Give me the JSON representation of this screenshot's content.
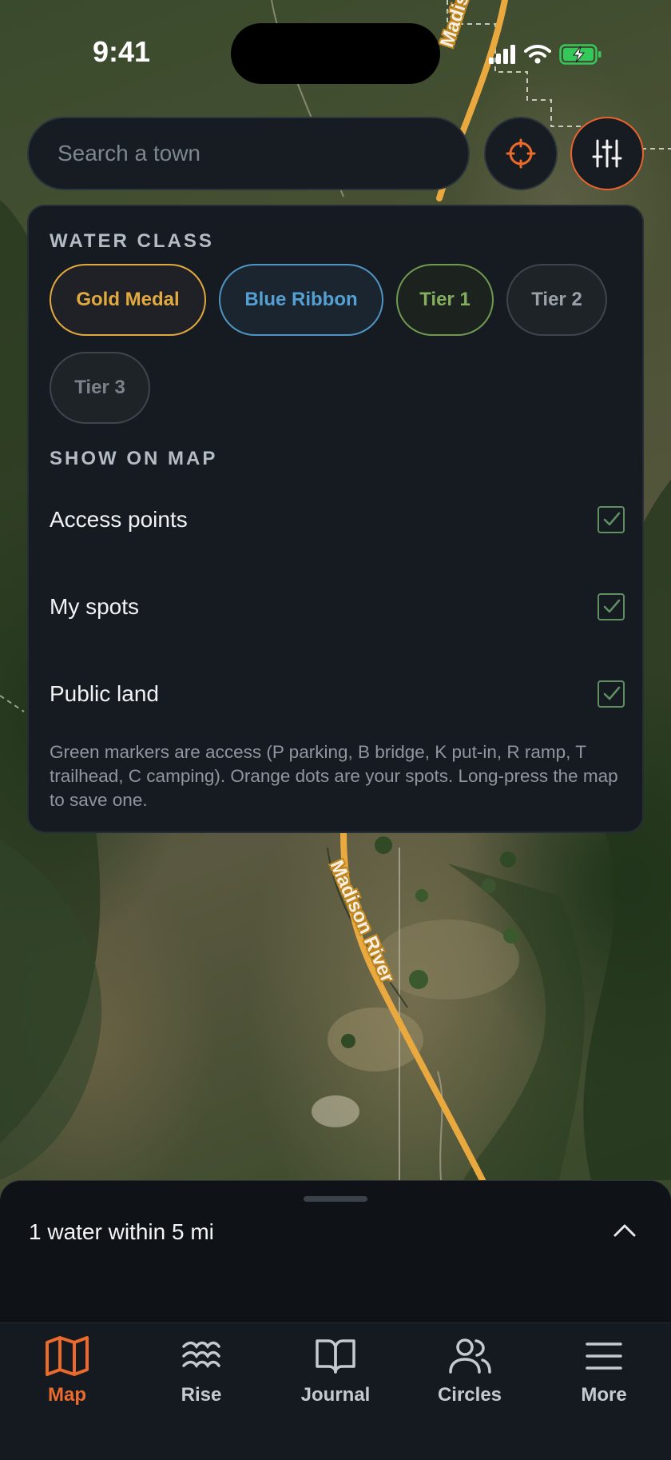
{
  "status_bar": {
    "time": "9:41"
  },
  "map": {
    "river_labels": [
      "Madison River",
      "Madison River"
    ]
  },
  "search": {
    "placeholder": "Search a town"
  },
  "filter_panel": {
    "water_class_title": "WATER CLASS",
    "water_classes": [
      "Gold Medal",
      "Blue Ribbon",
      "Tier 1",
      "Tier 2",
      "Tier 3"
    ],
    "show_on_map_title": "SHOW ON MAP",
    "toggles": [
      {
        "label": "Access points",
        "checked": true
      },
      {
        "label": "My spots",
        "checked": true
      },
      {
        "label": "Public land",
        "checked": true
      }
    ],
    "legend_note": "Green markers are access (P parking, B bridge, K put-in, R ramp, T trailhead, C camping). Orange dots are your spots. Long-press the map to save one."
  },
  "bottom_sheet": {
    "summary": "1 water within 5 mi"
  },
  "tab_bar": {
    "tabs": [
      {
        "label": "Map",
        "icon": "map-icon",
        "active": true
      },
      {
        "label": "Rise",
        "icon": "waves-icon",
        "active": false
      },
      {
        "label": "Journal",
        "icon": "book-icon",
        "active": false
      },
      {
        "label": "Circles",
        "icon": "users-icon",
        "active": false
      },
      {
        "label": "More",
        "icon": "menu-icon",
        "active": false
      }
    ]
  },
  "colors": {
    "accent": "#ec6a2c",
    "gold_medal": "#e2a93e",
    "blue_ribbon": "#55a0d2",
    "tier1": "#84ad60",
    "checkbox": "#5f8f63",
    "panel_bg": "#161b21"
  }
}
